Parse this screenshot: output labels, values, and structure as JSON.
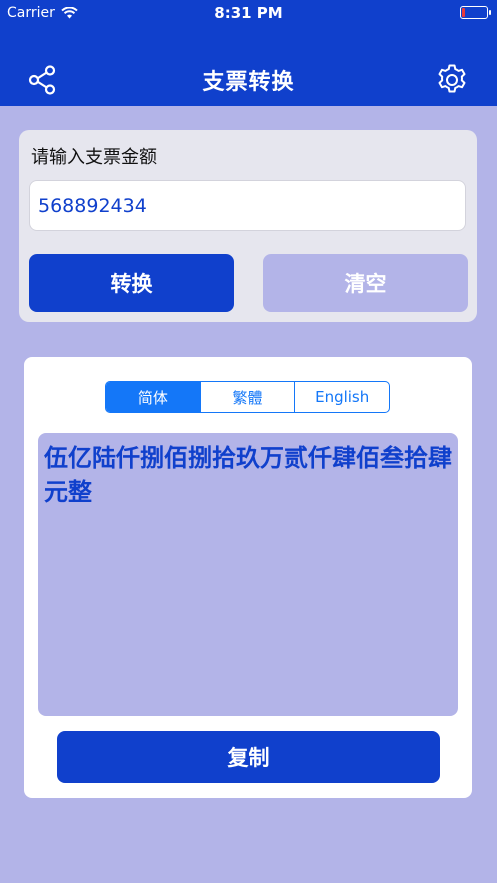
{
  "status_bar": {
    "carrier": "Carrier",
    "time": "8:31 PM",
    "battery_level": 0.15
  },
  "nav": {
    "title": "支票转换",
    "share_icon": "share-icon",
    "settings_icon": "gear-icon"
  },
  "input_section": {
    "label": "请输入支票金额",
    "amount_value": "568892434",
    "convert_label": "转换",
    "clear_label": "清空"
  },
  "result_section": {
    "tabs": [
      {
        "label": "简体",
        "active": true
      },
      {
        "label": "繁體",
        "active": false
      },
      {
        "label": "English",
        "active": false
      }
    ],
    "result_text": "伍亿陆仟捌佰捌拾玖万贰仟肆佰叁拾肆元整",
    "copy_label": "复制"
  },
  "colors": {
    "primary": "#1040cc",
    "light": "#b3b4e8",
    "segment_blue": "#1477f8",
    "card_gray": "#e6e6ee"
  }
}
